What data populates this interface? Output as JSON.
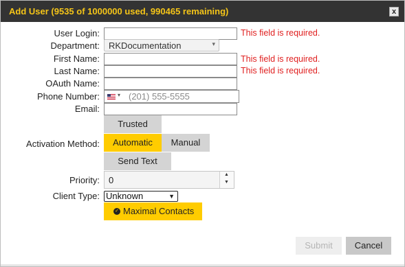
{
  "dialog": {
    "title": "Add User (9535 of 1000000 used, 990465 remaining)",
    "close_label": "x"
  },
  "form": {
    "user_login_label": "User Login:",
    "user_login_value": "",
    "user_login_error": "This field is required.",
    "department_label": "Department:",
    "department_value": "RKDocumentation",
    "first_name_label": "First Name:",
    "first_name_value": "",
    "first_name_error": "This field is required.",
    "last_name_label": "Last Name:",
    "last_name_value": "",
    "last_name_error": "This field is required.",
    "oauth_name_label": "OAuth Name:",
    "oauth_name_value": "",
    "phone_label": "Phone Number:",
    "phone_placeholder": "(201) 555-5555",
    "email_label": "Email:",
    "email_value": "",
    "activation_label": "Activation Method:",
    "activation_options": [
      "Trusted",
      "Automatic",
      "Manual",
      "Send Text"
    ],
    "activation_selected": "Automatic",
    "priority_label": "Priority:",
    "priority_value": "0",
    "client_type_label": "Client Type:",
    "client_type_value": "Unknown",
    "maximal_contacts_label": "Maximal Contacts",
    "maximal_contacts_checked": true
  },
  "footer": {
    "submit_label": "Submit",
    "cancel_label": "Cancel"
  },
  "colors": {
    "accent": "#ffcc00",
    "title_bar": "#333333",
    "title_text": "#f5c518",
    "error": "#e02020"
  },
  "icons": {
    "close": "close-icon",
    "flag": "us-flag-icon",
    "check": "check-circle-icon"
  }
}
